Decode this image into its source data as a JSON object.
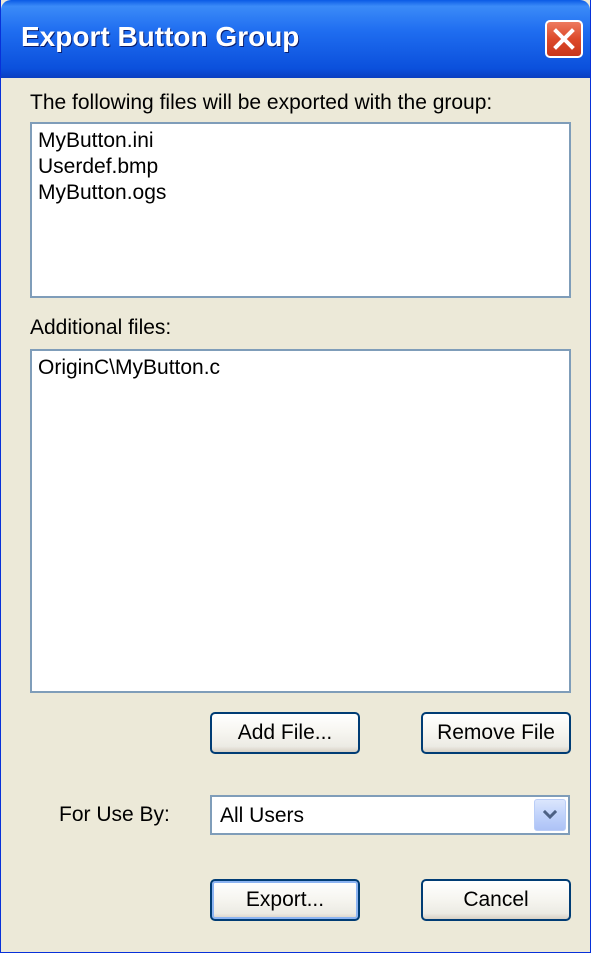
{
  "window": {
    "title": "Export Button Group",
    "close_icon": "close-icon"
  },
  "exported_files": {
    "label": "The following files will be exported with the group:",
    "items": [
      "MyButton.ini",
      "Userdef.bmp",
      "MyButton.ogs"
    ]
  },
  "additional_files": {
    "label": "Additional files:",
    "items": [
      "OriginC\\MyButton.c"
    ]
  },
  "buttons": {
    "add_file": "Add File...",
    "remove_file": "Remove File",
    "export": "Export...",
    "cancel": "Cancel"
  },
  "for_use_by": {
    "label": "For Use By:",
    "selected": "All Users",
    "arrow_icon": "chevron-down-icon"
  },
  "colors": {
    "titlebar": "#0a5ae6",
    "dialog_bg": "#ece9d8",
    "close_button": "#dd4a2a",
    "button_border": "#003c74"
  }
}
